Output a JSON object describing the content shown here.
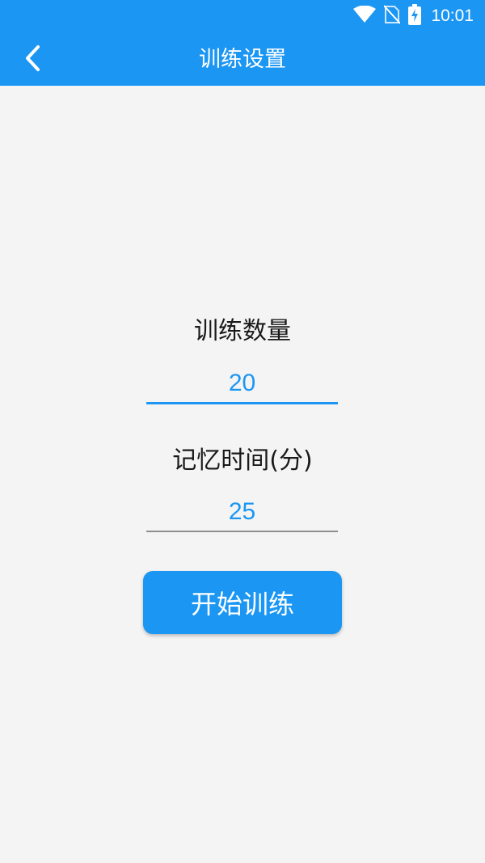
{
  "status_bar": {
    "time": "10:01",
    "icons": [
      "wifi-icon",
      "no-sim-icon",
      "battery-charging-icon"
    ]
  },
  "app_bar": {
    "title": "训练设置",
    "back_icon": "chevron-left-icon"
  },
  "form": {
    "count_label": "训练数量",
    "count_value": "20",
    "time_label": "记忆时间(分)",
    "time_value": "25",
    "start_button": "开始训练"
  },
  "colors": {
    "primary": "#1b96f3",
    "background": "#f4f4f4",
    "text": "#1a1a1a"
  }
}
